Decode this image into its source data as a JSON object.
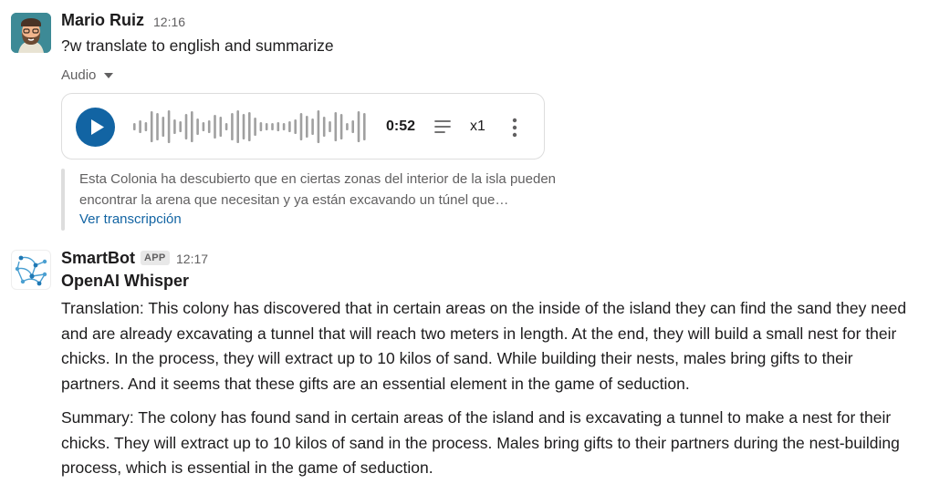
{
  "messages": [
    {
      "author": "Mario Ruiz",
      "time": "12:16",
      "text": "?w translate to english and summarize",
      "attachment": {
        "toggle_label": "Audio",
        "duration": "0:52",
        "speed": "x1",
        "transcript_preview": "Esta Colonia ha descubierto que en ciertas zonas del interior de la isla pueden encontrar la arena que necesitan y ya están excavando un túnel que…",
        "transcript_link": "Ver transcripción"
      }
    },
    {
      "author": "SmartBot",
      "badge": "APP",
      "time": "12:17",
      "title": "OpenAI Whisper",
      "translation": "Translation: This colony has discovered that in certain areas on the inside of the island they can find the sand they need and are already excavating a tunnel that will reach two meters in length. At the end, they will build a small nest for their chicks. In the process, they will extract up to 10 kilos of sand. While building their nests, males bring gifts to their partners. And it seems that these gifts are an essential element in the game of seduction.",
      "summary": "Summary: The colony has found sand in certain areas of the island and is excavating a tunnel to make a nest for their chicks. They will extract up to 10 kilos of sand in the process. Males bring gifts to their partners during the nest-building process, which is essential in the game of seduction."
    }
  ],
  "icons": {
    "play": "play-icon",
    "transcript": "lines-icon",
    "more": "vertical-dots-icon",
    "caret": "caret-down-icon"
  },
  "colors": {
    "accent": "#1264a3",
    "muted_text": "#616061",
    "border": "#dddddd"
  }
}
